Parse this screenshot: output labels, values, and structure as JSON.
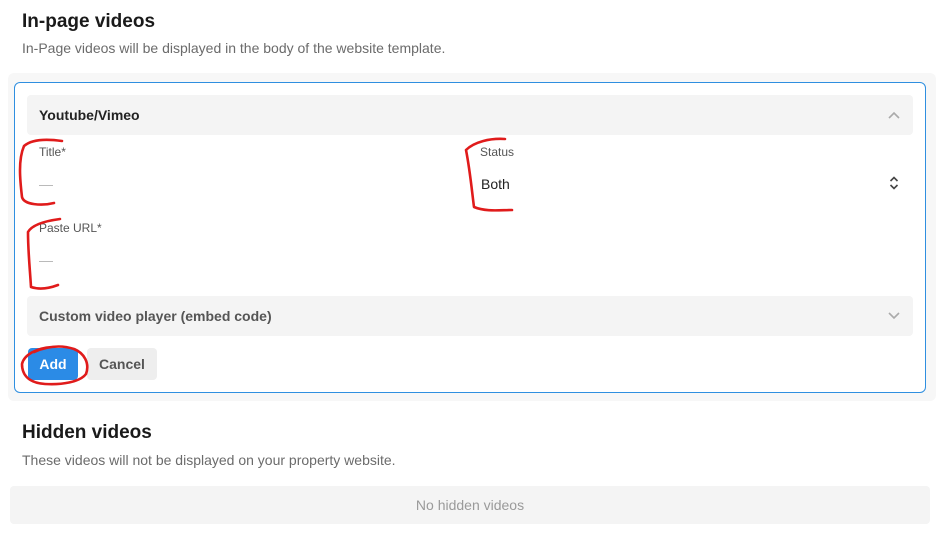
{
  "inpage": {
    "title": "In-page videos",
    "description": "In-Page videos will be displayed in the body of the website template."
  },
  "form": {
    "youtube_header": "Youtube/Vimeo",
    "title_label": "Title*",
    "title_placeholder": "—",
    "status_label": "Status",
    "status_value": "Both",
    "url_label": "Paste URL*",
    "url_placeholder": "—",
    "custom_header": "Custom video player (embed code)",
    "add_label": "Add",
    "cancel_label": "Cancel"
  },
  "hidden": {
    "title": "Hidden videos",
    "description": "These videos will not be displayed on your property website.",
    "empty_text": "No hidden videos"
  },
  "colors": {
    "accent": "#2b8be6",
    "annotation": "#e01b1b"
  }
}
